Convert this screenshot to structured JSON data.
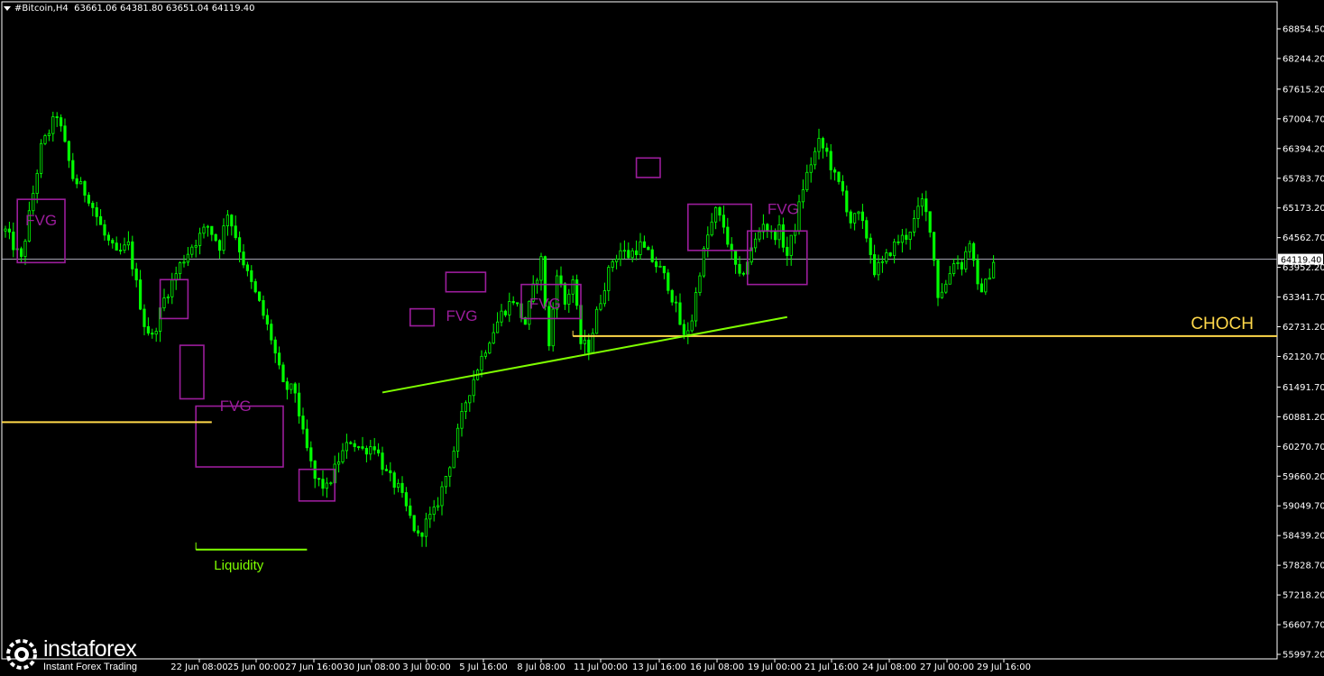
{
  "header": {
    "symbol": "#Bitcoin,H4",
    "ohlc": "63661.06 64381.80 63651.04 64119.40"
  },
  "price_label": "64119.40",
  "logo": {
    "name": "instaforex",
    "tagline": "Instant Forex Trading"
  },
  "colors": {
    "bull": "#00ff00",
    "bear": "#00ff00",
    "fvg": "#9c1d9c",
    "liquidity_line": "#7fff00",
    "support_line": "#ffd84a",
    "axis_text": "#ffffff",
    "price_line": "#b9b9c8"
  },
  "chart_data": {
    "type": "candlestick",
    "title": "#Bitcoin,H4",
    "x_ticks": [
      "22 Jun 08:00",
      "25 Jun 00:00",
      "27 Jun 16:00",
      "30 Jun 08:00",
      "3 Jul 00:00",
      "5 Jul 16:00",
      "8 Jul 08:00",
      "11 Jul 00:00",
      "13 Jul 16:00",
      "16 Jul 08:00",
      "19 Jul 00:00",
      "21 Jul 16:00",
      "24 Jul 08:00",
      "27 Jul 00:00",
      "29 Jul 16:00"
    ],
    "y_ticks": [
      68854.5,
      68244.2,
      67615.2,
      67004.7,
      66394.2,
      65783.7,
      65173.2,
      64562.7,
      63952.2,
      63341.7,
      62731.2,
      62120.7,
      61491.7,
      60881.2,
      60270.7,
      59660.2,
      59049.7,
      58439.2,
      57828.7,
      57218.2,
      56607.7,
      55997.2
    ],
    "y_range": [
      55997.2,
      68854.5
    ],
    "current_price": 64119.4,
    "trend_path": [
      [
        0,
        64700
      ],
      [
        4,
        64100
      ],
      [
        9,
        66400
      ],
      [
        13,
        67100
      ],
      [
        17,
        65800
      ],
      [
        21,
        65400
      ],
      [
        25,
        64600
      ],
      [
        28,
        64200
      ],
      [
        31,
        64400
      ],
      [
        35,
        62800
      ],
      [
        37,
        62500
      ],
      [
        40,
        63300
      ],
      [
        44,
        64000
      ],
      [
        47,
        64400
      ],
      [
        51,
        64800
      ],
      [
        54,
        64400
      ],
      [
        56,
        65100
      ],
      [
        58,
        64600
      ],
      [
        61,
        63800
      ],
      [
        64,
        63200
      ],
      [
        67,
        62500
      ],
      [
        70,
        61500
      ],
      [
        73,
        61400
      ],
      [
        75,
        60500
      ],
      [
        78,
        59600
      ],
      [
        81,
        59400
      ],
      [
        84,
        60000
      ],
      [
        87,
        60400
      ],
      [
        90,
        60200
      ],
      [
        93,
        60300
      ],
      [
        96,
        59700
      ],
      [
        99,
        59400
      ],
      [
        102,
        58800
      ],
      [
        104,
        58400
      ],
      [
        106,
        58700
      ],
      [
        108,
        58900
      ],
      [
        110,
        59400
      ],
      [
        113,
        60200
      ],
      [
        116,
        61200
      ],
      [
        119,
        61900
      ],
      [
        122,
        62500
      ],
      [
        125,
        63000
      ],
      [
        128,
        63300
      ],
      [
        131,
        62800
      ],
      [
        133,
        63500
      ],
      [
        135,
        64100
      ],
      [
        137,
        62300
      ],
      [
        139,
        63900
      ],
      [
        141,
        63200
      ],
      [
        143,
        63700
      ],
      [
        145,
        62400
      ],
      [
        147,
        62300
      ],
      [
        149,
        63000
      ],
      [
        151,
        63600
      ],
      [
        153,
        64100
      ],
      [
        155,
        64300
      ],
      [
        157,
        64200
      ],
      [
        160,
        64400
      ],
      [
        163,
        64100
      ],
      [
        165,
        63900
      ],
      [
        167,
        63600
      ],
      [
        169,
        63100
      ],
      [
        171,
        62500
      ],
      [
        173,
        62900
      ],
      [
        175,
        63900
      ],
      [
        177,
        64600
      ],
      [
        179,
        65100
      ],
      [
        181,
        64800
      ],
      [
        183,
        64200
      ],
      [
        185,
        63700
      ],
      [
        187,
        64100
      ],
      [
        189,
        64500
      ],
      [
        191,
        64900
      ],
      [
        193,
        64600
      ],
      [
        195,
        64700
      ],
      [
        197,
        64200
      ],
      [
        199,
        64800
      ],
      [
        201,
        65600
      ],
      [
        203,
        66100
      ],
      [
        205,
        66500
      ],
      [
        207,
        66300
      ],
      [
        209,
        65800
      ],
      [
        211,
        65500
      ],
      [
        213,
        64900
      ],
      [
        215,
        65000
      ],
      [
        217,
        64600
      ],
      [
        219,
        63900
      ],
      [
        221,
        64000
      ],
      [
        223,
        64300
      ],
      [
        225,
        64500
      ],
      [
        227,
        64600
      ],
      [
        229,
        64900
      ],
      [
        231,
        65300
      ],
      [
        233,
        64800
      ],
      [
        235,
        63400
      ],
      [
        237,
        63600
      ],
      [
        239,
        64100
      ],
      [
        241,
        64000
      ],
      [
        243,
        64500
      ],
      [
        245,
        63500
      ],
      [
        247,
        63600
      ],
      [
        249,
        64100
      ]
    ],
    "x_count": 250,
    "annotations": {
      "fvg_boxes": [
        {
          "x0": 3,
          "x1": 15,
          "top": 65350,
          "bottom": 64050
        },
        {
          "x0": 39,
          "x1": 46,
          "top": 63700,
          "bottom": 62900
        },
        {
          "x0": 44,
          "x1": 50,
          "top": 62350,
          "bottom": 61250
        },
        {
          "x0": 48,
          "x1": 70,
          "top": 61100,
          "bottom": 59850
        },
        {
          "x0": 74,
          "x1": 83,
          "top": 59800,
          "bottom": 59150
        },
        {
          "x0": 102,
          "x1": 108,
          "top": 63100,
          "bottom": 62750
        },
        {
          "x0": 111,
          "x1": 121,
          "top": 63850,
          "bottom": 63450
        },
        {
          "x0": 130,
          "x1": 145,
          "top": 63600,
          "bottom": 62900
        },
        {
          "x0": 159,
          "x1": 165,
          "top": 66200,
          "bottom": 65800
        },
        {
          "x0": 172,
          "x1": 188,
          "top": 65250,
          "bottom": 64300
        },
        {
          "x0": 187,
          "x1": 202,
          "top": 64700,
          "bottom": 63600
        }
      ],
      "fvg_labels": [
        {
          "text": "FVG",
          "x": 9,
          "y": 64820
        },
        {
          "text": "FVG",
          "x": 58,
          "y": 61000
        },
        {
          "text": "FVG",
          "x": 115,
          "y": 62850
        },
        {
          "text": "FVG",
          "x": 136,
          "y": 63100
        },
        {
          "text": "FVG",
          "x": 196,
          "y": 65050
        }
      ],
      "liquidity": {
        "x0": 48,
        "x1": 76,
        "price": 58150,
        "label": "Liquidity"
      },
      "support_line_1": {
        "x0": 0,
        "x1": 52,
        "price": 60770
      },
      "support_line_2": {
        "x0": 143,
        "x1": 252,
        "price": 62540,
        "label": "CHOCH"
      },
      "trendline": {
        "x0": 95,
        "x1": 197,
        "p0": 61380,
        "p1": 62930
      }
    }
  }
}
